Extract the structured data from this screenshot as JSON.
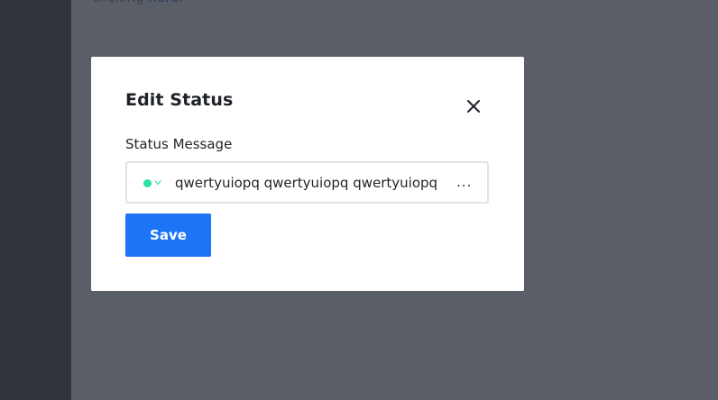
{
  "background": {
    "text_prefix": "clicking ",
    "link_text": "here",
    "text_suffix": "."
  },
  "modal": {
    "title": "Edit Status",
    "close_icon": "close-icon",
    "field_label": "Status Message",
    "status": {
      "dot_color": "#2de0a5",
      "dot_icon": "status-online-dot",
      "chevron_icon": "chevron-down-icon",
      "message_value": "qwertyuiopq qwertyuiopq qwertyuiopq",
      "overflow_indicator": "..."
    },
    "save_label": "Save"
  },
  "colors": {
    "accent": "#1d74f5",
    "overlay": "#5a5e66",
    "sidebar": "#2f333a",
    "status_online": "#2de0a5"
  }
}
